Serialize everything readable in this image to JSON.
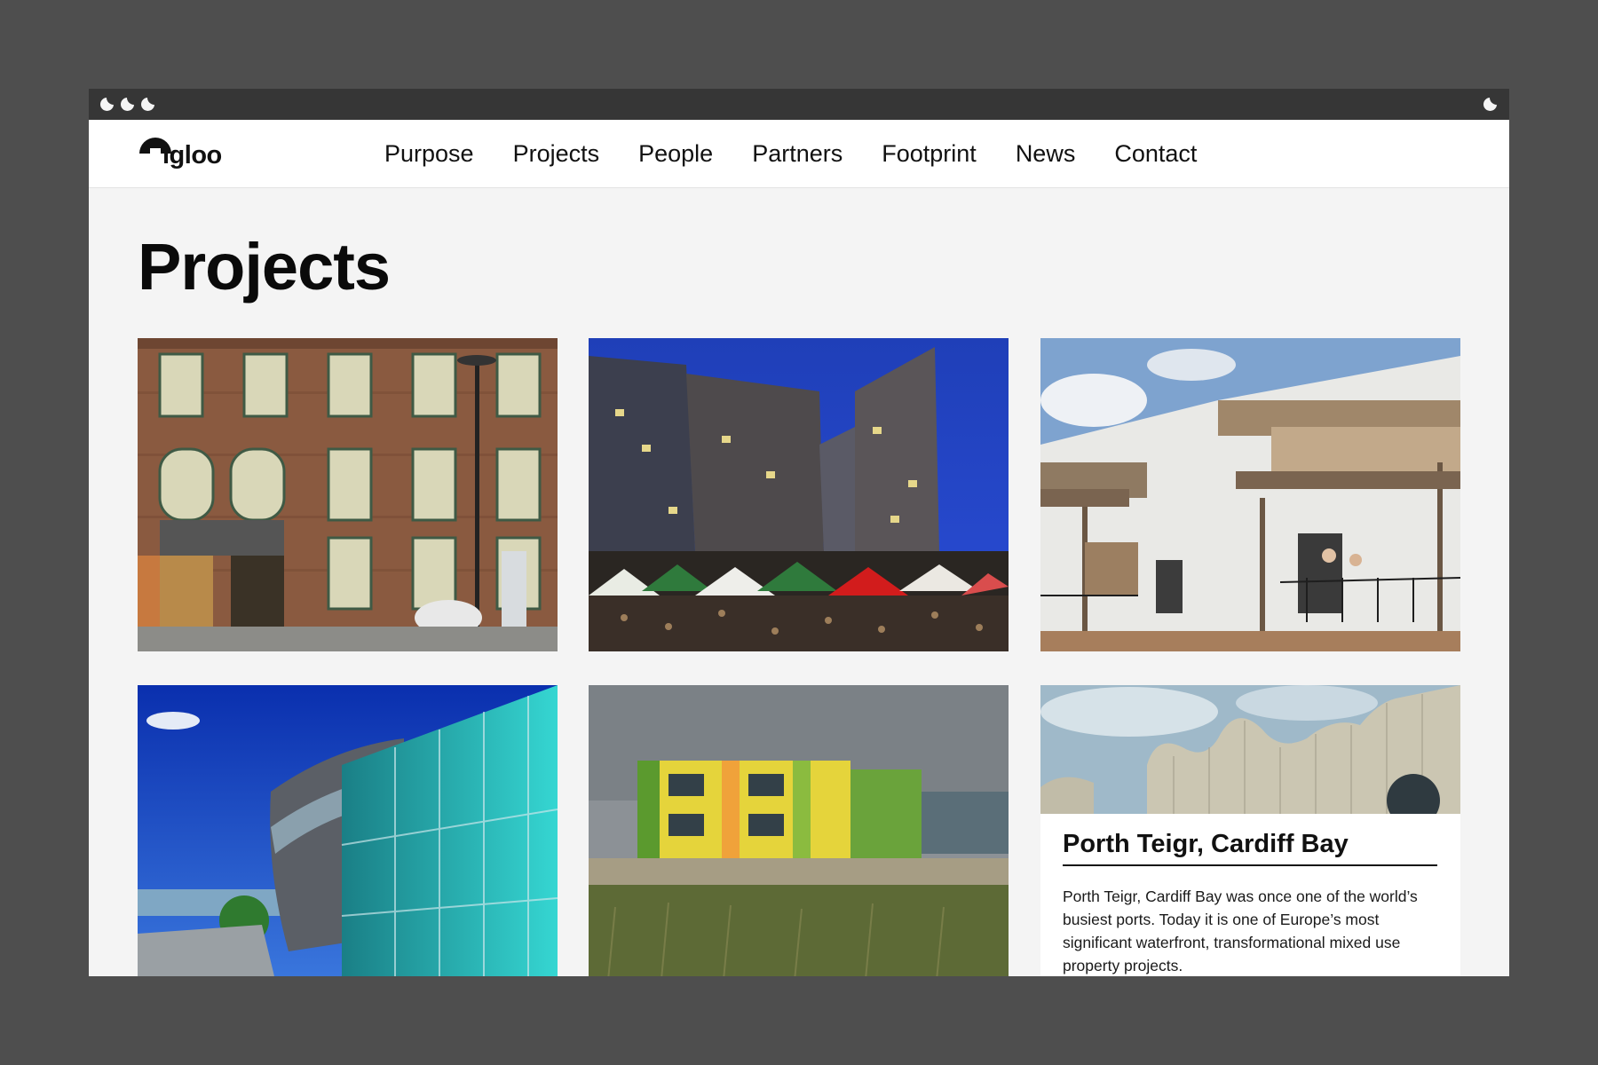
{
  "brand": {
    "logo_text": "igloo"
  },
  "nav": {
    "items": [
      {
        "label": "Purpose"
      },
      {
        "label": "Projects"
      },
      {
        "label": "People"
      },
      {
        "label": "Partners"
      },
      {
        "label": "Footprint"
      },
      {
        "label": "News"
      },
      {
        "label": "Contact"
      }
    ]
  },
  "page": {
    "title": "Projects"
  },
  "projects": [
    {
      "image": "brick-warehouse-photo"
    },
    {
      "image": "night-market-photo"
    },
    {
      "image": "white-townhouses-photo"
    },
    {
      "image": "glass-curved-building-photo"
    },
    {
      "image": "colorful-school-photo"
    },
    {
      "image": "wavy-timber-facade-photo",
      "title": "Porth Teigr, Cardiff Bay",
      "description": "Porth Teigr, Cardiff Bay was once one of the world’s busiest ports. Today it is one of Europe’s most significant waterfront, transformational mixed use property projects."
    }
  ],
  "colors": {
    "background": "#4e4e4e",
    "page": "#f4f4f4",
    "titlebar": "#363636",
    "text": "#111111"
  }
}
